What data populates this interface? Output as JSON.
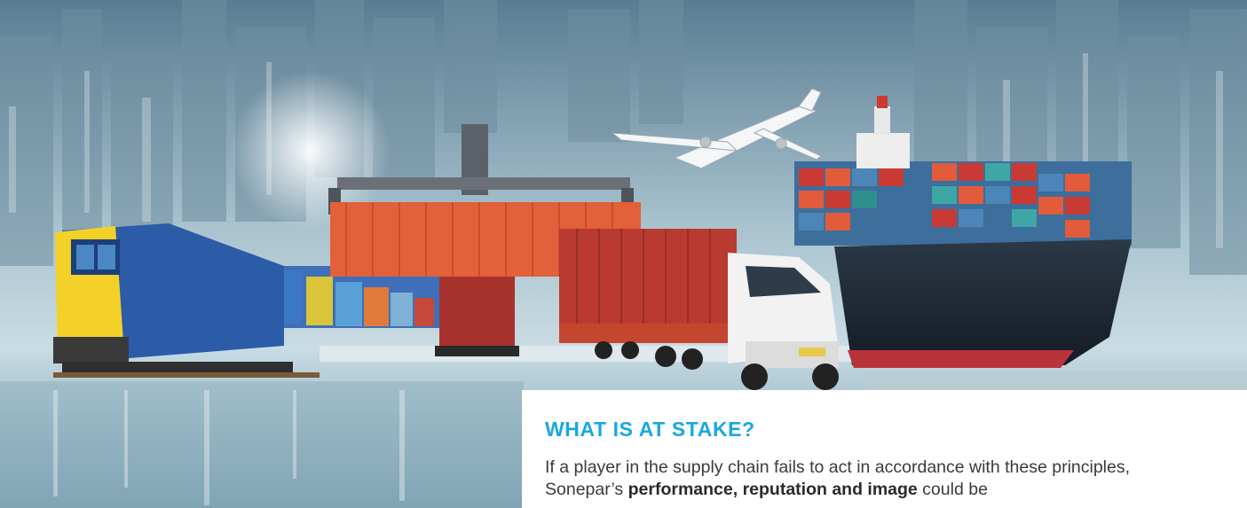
{
  "hero": {
    "image_description_icon": "logistics-collage-icon",
    "colors": {
      "sky_top": "#5d7f94",
      "sky_bottom": "#c7dbe3",
      "container_orange": "#e2603a",
      "container_red": "#b83a30",
      "train_yellow": "#f3d128",
      "train_blue": "#2c5ba8",
      "ship_hull": "#1e2a36",
      "ship_bottom": "#b8333a",
      "truck_white": "#f2f2f2"
    }
  },
  "section": {
    "title": "WHAT IS AT STAKE?",
    "body_part1": "If a player in the supply chain fails to act in accordance with these principles, Sonepar’s ",
    "body_bold": "performance, reputation and image",
    "body_part2": " could be"
  },
  "colors": {
    "accent": "#19a7e0",
    "text": "#3a3a3a"
  }
}
